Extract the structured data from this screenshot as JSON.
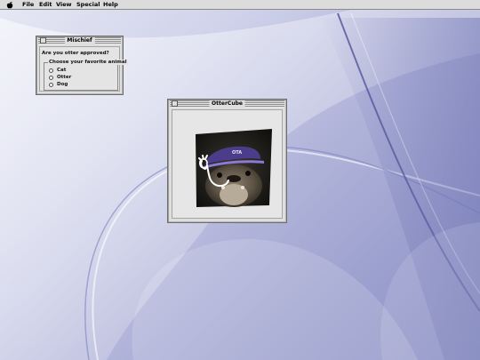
{
  "menubar": {
    "apple_icon": "apple-icon",
    "items": [
      "File",
      "Edit",
      "View",
      "Special",
      "Help"
    ]
  },
  "mischief_window": {
    "title": "Mischief",
    "question": "Are you otter approved?",
    "group_label": "Choose your favorite animal",
    "options": [
      {
        "label": "Cat",
        "selected": false
      },
      {
        "label": "Otter",
        "selected": false
      },
      {
        "label": "Dog",
        "selected": false
      }
    ]
  },
  "ottercube_window": {
    "title": "OtterCube",
    "image": "otter-wearing-purple-cap-photo",
    "cap_text": "OTA"
  },
  "colors": {
    "desktop_light": "#e7e8f4",
    "desktop_dark": "#8a8fc4",
    "window_bg": "#dedede",
    "cap": "#4b3d8a"
  }
}
